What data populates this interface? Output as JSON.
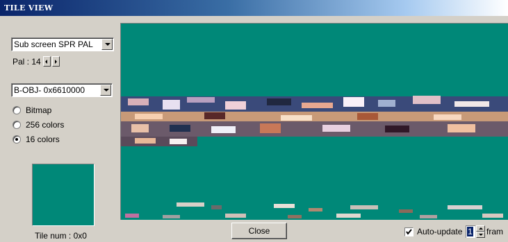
{
  "window": {
    "title": "TILE VIEW"
  },
  "palette_select": {
    "value": "Sub screen SPR PAL"
  },
  "pal": {
    "label": "Pal : 14"
  },
  "memory_select": {
    "value": "B-OBJ- 0x6610000"
  },
  "modes": [
    {
      "label": "Bitmap",
      "selected": false
    },
    {
      "label": "256 colors",
      "selected": false
    },
    {
      "label": "16 colors",
      "selected": true
    }
  ],
  "tile_num": {
    "label": "Tile num : 0x0"
  },
  "close_button": {
    "label": "Close"
  },
  "auto_update": {
    "label": "Auto-update",
    "checked": true
  },
  "frame_count": {
    "value": "1",
    "suffix": "fram"
  },
  "colors": {
    "background": "#008878",
    "window": "#d4d0c8",
    "titlebar": "#0a246a"
  }
}
